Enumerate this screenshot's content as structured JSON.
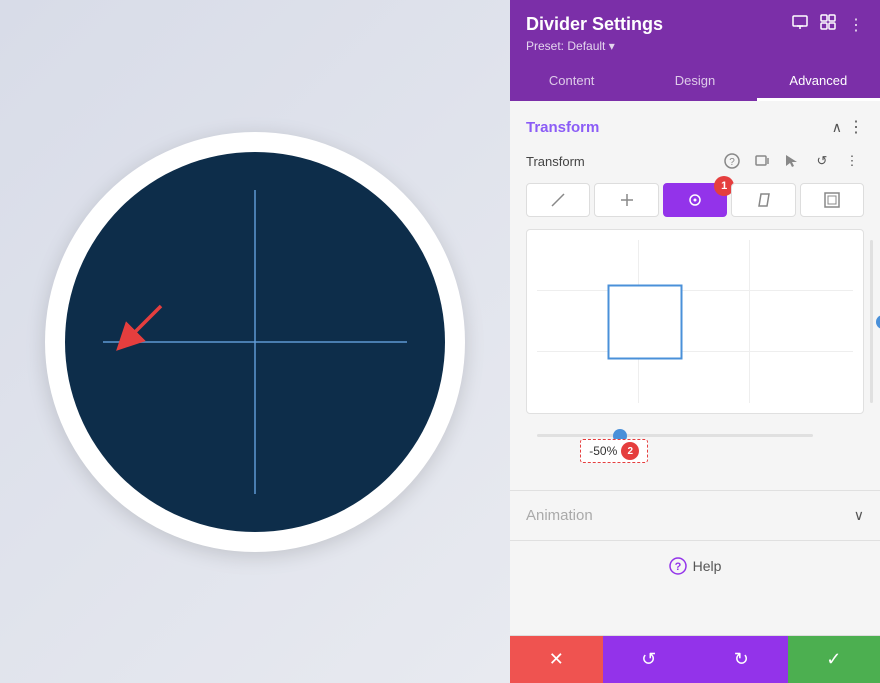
{
  "header": {
    "title": "Divider Settings",
    "preset": "Preset: Default",
    "icons": [
      "screen-icon",
      "grid-icon",
      "dots-icon"
    ]
  },
  "tabs": [
    {
      "label": "Content",
      "active": false
    },
    {
      "label": "Design",
      "active": false
    },
    {
      "label": "Advanced",
      "active": true
    }
  ],
  "transform": {
    "section_title": "Transform",
    "label": "Transform",
    "type_buttons": [
      {
        "icon": "↖",
        "label": "move-diagonal"
      },
      {
        "icon": "+",
        "label": "translate"
      },
      {
        "icon": "●",
        "label": "rotate",
        "active": true,
        "badge": "1"
      },
      {
        "icon": "◇",
        "label": "skew"
      },
      {
        "icon": "⊡",
        "label": "scale"
      }
    ],
    "vertical_value": "0px",
    "horizontal_value": "-50%",
    "badge_2_label": "2"
  },
  "animation": {
    "section_title": "Animation"
  },
  "help": {
    "label": "Help"
  },
  "bottom_toolbar": {
    "cancel": "✕",
    "reset": "↺",
    "redo": "↻",
    "confirm": "✓"
  }
}
